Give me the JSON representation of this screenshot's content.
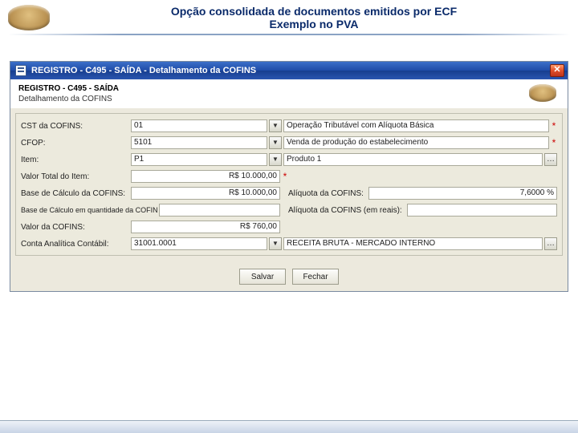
{
  "header": {
    "title1": "Opção consolidada de documentos emitidos por ECF",
    "title2": "Exemplo no PVA"
  },
  "window": {
    "title": "REGISTRO - C495 - SAÍDA - Detalhamento da COFINS",
    "close_symbol": "✕"
  },
  "panel_header": {
    "title": "REGISTRO - C495 - SAÍDA",
    "subtitle": "Detalhamento da COFINS"
  },
  "form": {
    "cst": {
      "label": "CST da COFINS:",
      "code": "01",
      "desc": "Operação Tributável com Alíquota Básica"
    },
    "cfop": {
      "label": "CFOP:",
      "code": "5101",
      "desc": "Venda de produção do estabelecimento"
    },
    "item": {
      "label": "Item:",
      "code": "P1",
      "desc": "Produto 1"
    },
    "valor_total": {
      "label": "Valor Total do Item:",
      "value": "R$ 10.000,00"
    },
    "base_calculo": {
      "label": "Base de Cálculo da COFINS:",
      "value": "R$ 10.000,00"
    },
    "aliquota": {
      "label": "Alíquota da COFINS:",
      "value": "7,6000 %"
    },
    "base_qtd": {
      "label": "Base de Cálculo em quantidade da COFINS:",
      "value": ""
    },
    "aliquota_reais": {
      "label": "Alíquota da COFINS (em reais):",
      "value": ""
    },
    "valor_cofins": {
      "label": "Valor da COFINS:",
      "value": "R$ 760,00"
    },
    "conta": {
      "label": "Conta Analítica Contábil:",
      "code": "31001.0001",
      "desc": "RECEITA BRUTA - MERCADO INTERNO"
    }
  },
  "buttons": {
    "save": "Salvar",
    "close": "Fechar"
  }
}
